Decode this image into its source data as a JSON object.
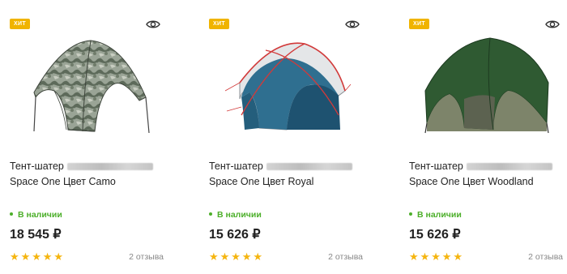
{
  "badge_color": "#f0b400",
  "stock_color": "#4caf2a",
  "star_color": "#f5b50f",
  "products": [
    {
      "badge": "ХИТ",
      "title_line1": "Тент-шатер",
      "title_line2": "Space One Цвет Camo",
      "stock": "В наличии",
      "price": "18 545 ₽",
      "rating": 5,
      "reviews": "2 отзыва",
      "image_icon": "camo-tent-image",
      "colors": {
        "body": "#8f9a8a",
        "dark": "#4f5a4c",
        "light": "#c9cfc2"
      }
    },
    {
      "badge": "ХИТ",
      "title_line1": "Тент-шатер",
      "title_line2": "Space One Цвет Royal",
      "stock": "В наличии",
      "price": "15 626 ₽",
      "rating": 5,
      "reviews": "2 отзыва",
      "image_icon": "royal-tent-image",
      "colors": {
        "body": "#2e6e8e",
        "dark": "#1d4a61",
        "light": "#e6e8ea"
      }
    },
    {
      "badge": "ХИТ",
      "title_line1": "Тент-шатер",
      "title_line2": "Space One Цвет Woodland",
      "stock": "В наличии",
      "price": "15 626 ₽",
      "rating": 5,
      "reviews": "2 отзыва",
      "image_icon": "woodland-tent-image",
      "colors": {
        "body": "#2f5a32",
        "dark": "#1d3a20",
        "light": "#7e8a6a"
      }
    }
  ]
}
